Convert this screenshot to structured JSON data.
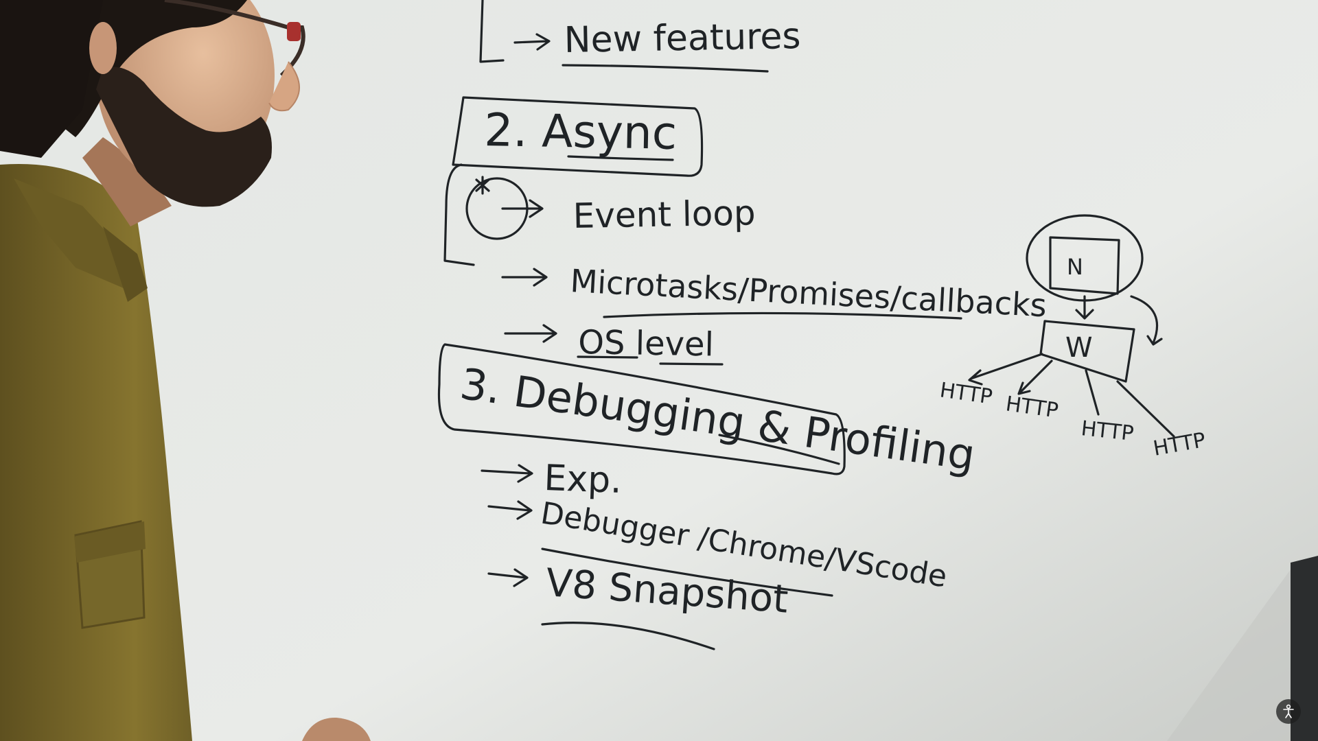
{
  "whiteboard": {
    "line_new_features": "New features",
    "heading_async": "2. Async",
    "line_event_loop": "Event loop",
    "line_microtasks": "Microtasks/Promises/callbacks",
    "line_os_level": "OS level",
    "heading_debugging": "3. Debugging & Profiling",
    "line_exp": "Exp.",
    "line_debugger": "Debugger /Chrome/VScode",
    "line_v8": "V8 Snapshot"
  },
  "diagram": {
    "node_n": "N",
    "node_w": "W",
    "http_labels": [
      "HTTP",
      "HTTP",
      "HTTP",
      "HTTP"
    ]
  },
  "overlay": {
    "accessibility_icon": "accessibility-icon"
  },
  "colors": {
    "board": "#e6e9e6",
    "marker": "#1f2326",
    "shirt": "#7a6a2c",
    "hair": "#1c1612"
  }
}
